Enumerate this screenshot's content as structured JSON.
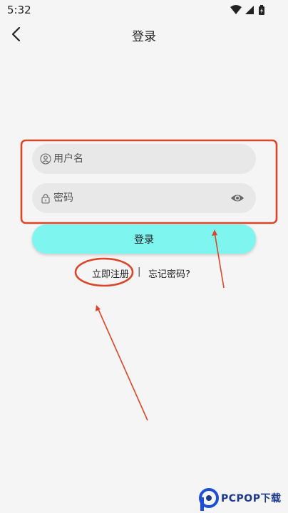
{
  "status_bar": {
    "time": "5:32"
  },
  "header": {
    "title": "登录"
  },
  "form": {
    "username_placeholder": "用户名",
    "password_placeholder": "密码",
    "login_label": "登录"
  },
  "links": {
    "register": "立即注册",
    "divider": "|",
    "forgot": "忘记密码?"
  },
  "colors": {
    "background": "#f5f5f5",
    "field": "#e8e8e8",
    "login_button": "#7ef6ef",
    "annotation": "#d9472b"
  },
  "watermark": {
    "logo_text": "PCPOP下载"
  }
}
